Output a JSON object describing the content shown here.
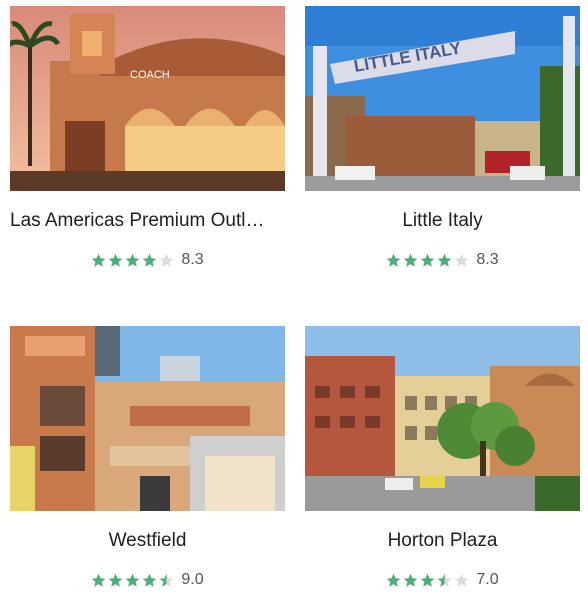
{
  "colors": {
    "star_filled": "#4caf7d",
    "star_empty": "#dcdcdc",
    "title_text": "#1f1f1f",
    "score_text": "#555555"
  },
  "places": [
    {
      "name": "Las Americas Premium Outl…",
      "photo_signage": "COACH",
      "rating_stars": 4,
      "score": "8.3"
    },
    {
      "name": "Little Italy",
      "photo_signage": "LITTLE ITALY",
      "rating_stars": 4,
      "score": "8.3"
    },
    {
      "name": "Westfield",
      "photo_signage": "",
      "rating_stars": 4.5,
      "score": "9.0"
    },
    {
      "name": "Horton Plaza",
      "photo_signage": "",
      "rating_stars": 3.5,
      "score": "7.0"
    }
  ]
}
